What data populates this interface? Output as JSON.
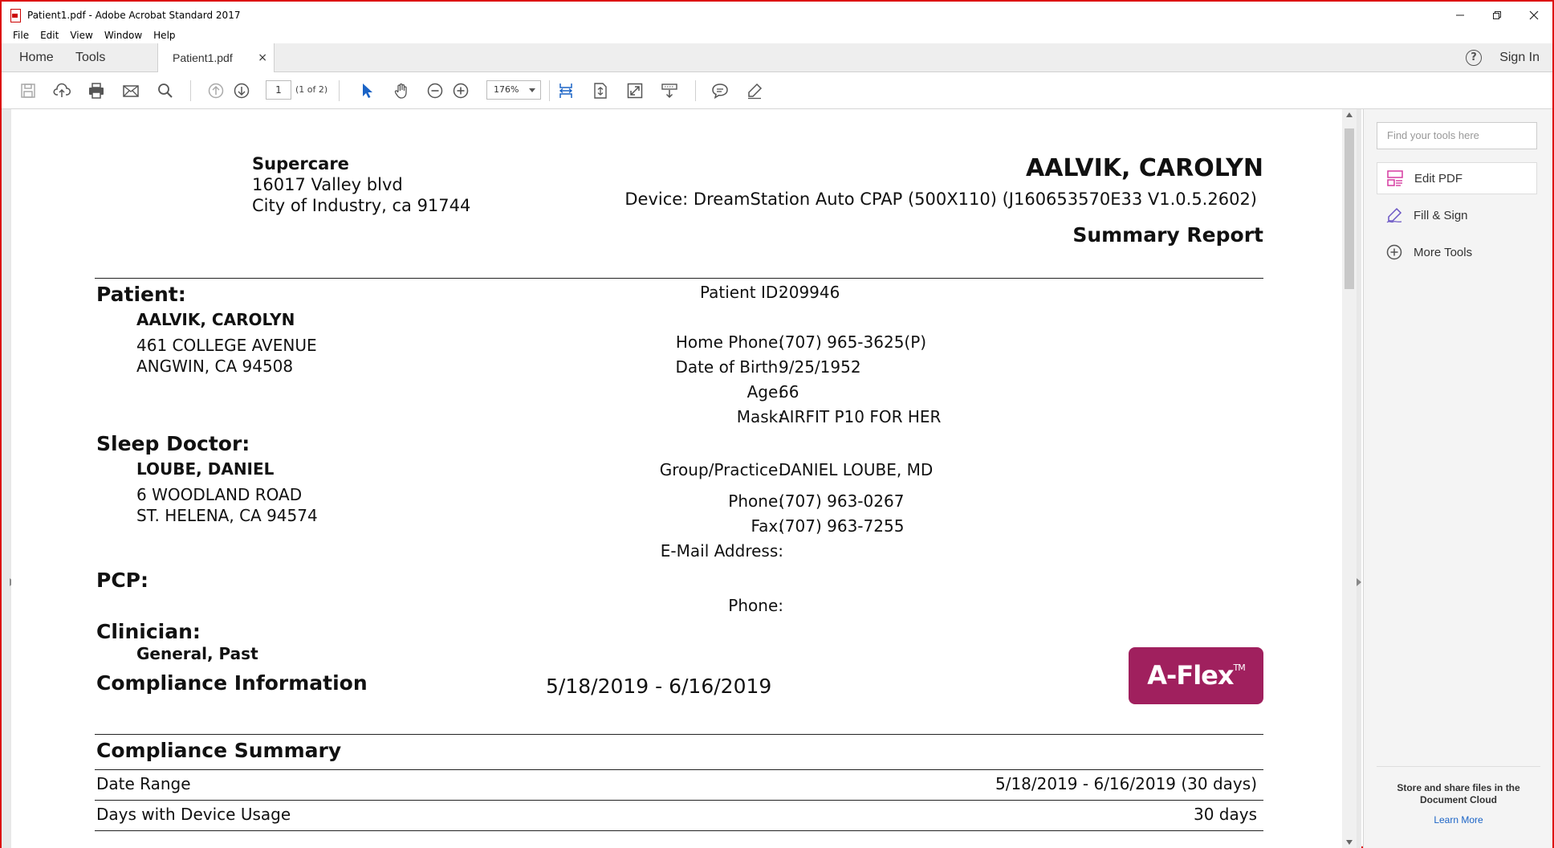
{
  "window": {
    "title": "Patient1.pdf - Adobe Acrobat Standard 2017",
    "controls": [
      "minimize",
      "restore",
      "close"
    ]
  },
  "menu": [
    "File",
    "Edit",
    "View",
    "Window",
    "Help"
  ],
  "tabs": {
    "home": "Home",
    "tools": "Tools",
    "document": "Patient1.pdf",
    "close": "×",
    "help": "?",
    "sign_in": "Sign In"
  },
  "toolbar": {
    "page_number": "1",
    "page_of": "(1 of 2)",
    "zoom": "176%",
    "icons": [
      "save-icon",
      "upload-icon",
      "print-icon",
      "email-icon",
      "search-icon",
      "previous-page-icon",
      "next-page-icon",
      "select-arrow-icon",
      "hand-icon",
      "zoom-out-icon",
      "zoom-in-icon",
      "fit-width-icon",
      "fit-page-icon",
      "fullscreen-icon",
      "scroll-mode-icon",
      "comment-icon",
      "highlight-icon"
    ]
  },
  "tools_pane": {
    "search_placeholder": "Find your tools here",
    "items": [
      "Edit PDF",
      "Fill & Sign",
      "More Tools"
    ],
    "cloud_line1": "Store and share files in the",
    "cloud_line2": "Document Cloud",
    "learn_more": "Learn More"
  },
  "report": {
    "provider_name": "Supercare",
    "provider_address1": "16017 Valley blvd",
    "provider_address2": "City of Industry, ca 91744",
    "patient_header": "AALVIK, CAROLYN",
    "device": "Device: DreamStation Auto CPAP (500X110) (J160653570E33 V1.0.5.2602)",
    "report_title": "Summary Report",
    "patient_heading": "Patient:",
    "patient_name": "AALVIK, CAROLYN",
    "patient_address1": "461 COLLEGE AVENUE",
    "patient_address2": "ANGWIN, CA 94508",
    "patient_id_label": "Patient ID:",
    "patient_id": "209946",
    "home_phone_label": "Home Phone:",
    "home_phone": "(707) 965-3625(P)",
    "dob_label": "Date of Birth:",
    "dob": "9/25/1952",
    "age_label": "Age:",
    "age": "66",
    "mask_label": "Mask:",
    "mask": "AIRFIT P10 FOR HER",
    "doctor_heading": "Sleep Doctor:",
    "doctor_name": "LOUBE, DANIEL",
    "doctor_address1": "6 WOODLAND ROAD",
    "doctor_address2": "ST. HELENA, CA 94574",
    "group_label": "Group/Practice:",
    "group": "DANIEL LOUBE, MD",
    "doc_phone_label": "Phone:",
    "doc_phone": "(707) 963-0267",
    "fax_label": "Fax:",
    "fax": "(707) 963-7255",
    "email_label": "E-Mail Address:",
    "pcp_heading": "PCP:",
    "pcp_phone_label": "Phone:",
    "clinician_heading": "Clinician:",
    "clinician_name": "General, Past",
    "compliance_info_heading": "Compliance Information",
    "compliance_range": "5/18/2019 - 6/16/2019",
    "badge_text": "A-Flex",
    "badge_tm": "TM",
    "summary_heading": "Compliance Summary",
    "summary_rows": [
      {
        "label": "Date Range",
        "value": "5/18/2019 - 6/16/2019 (30 days)"
      },
      {
        "label": "Days with Device Usage",
        "value": "30 days"
      }
    ]
  }
}
